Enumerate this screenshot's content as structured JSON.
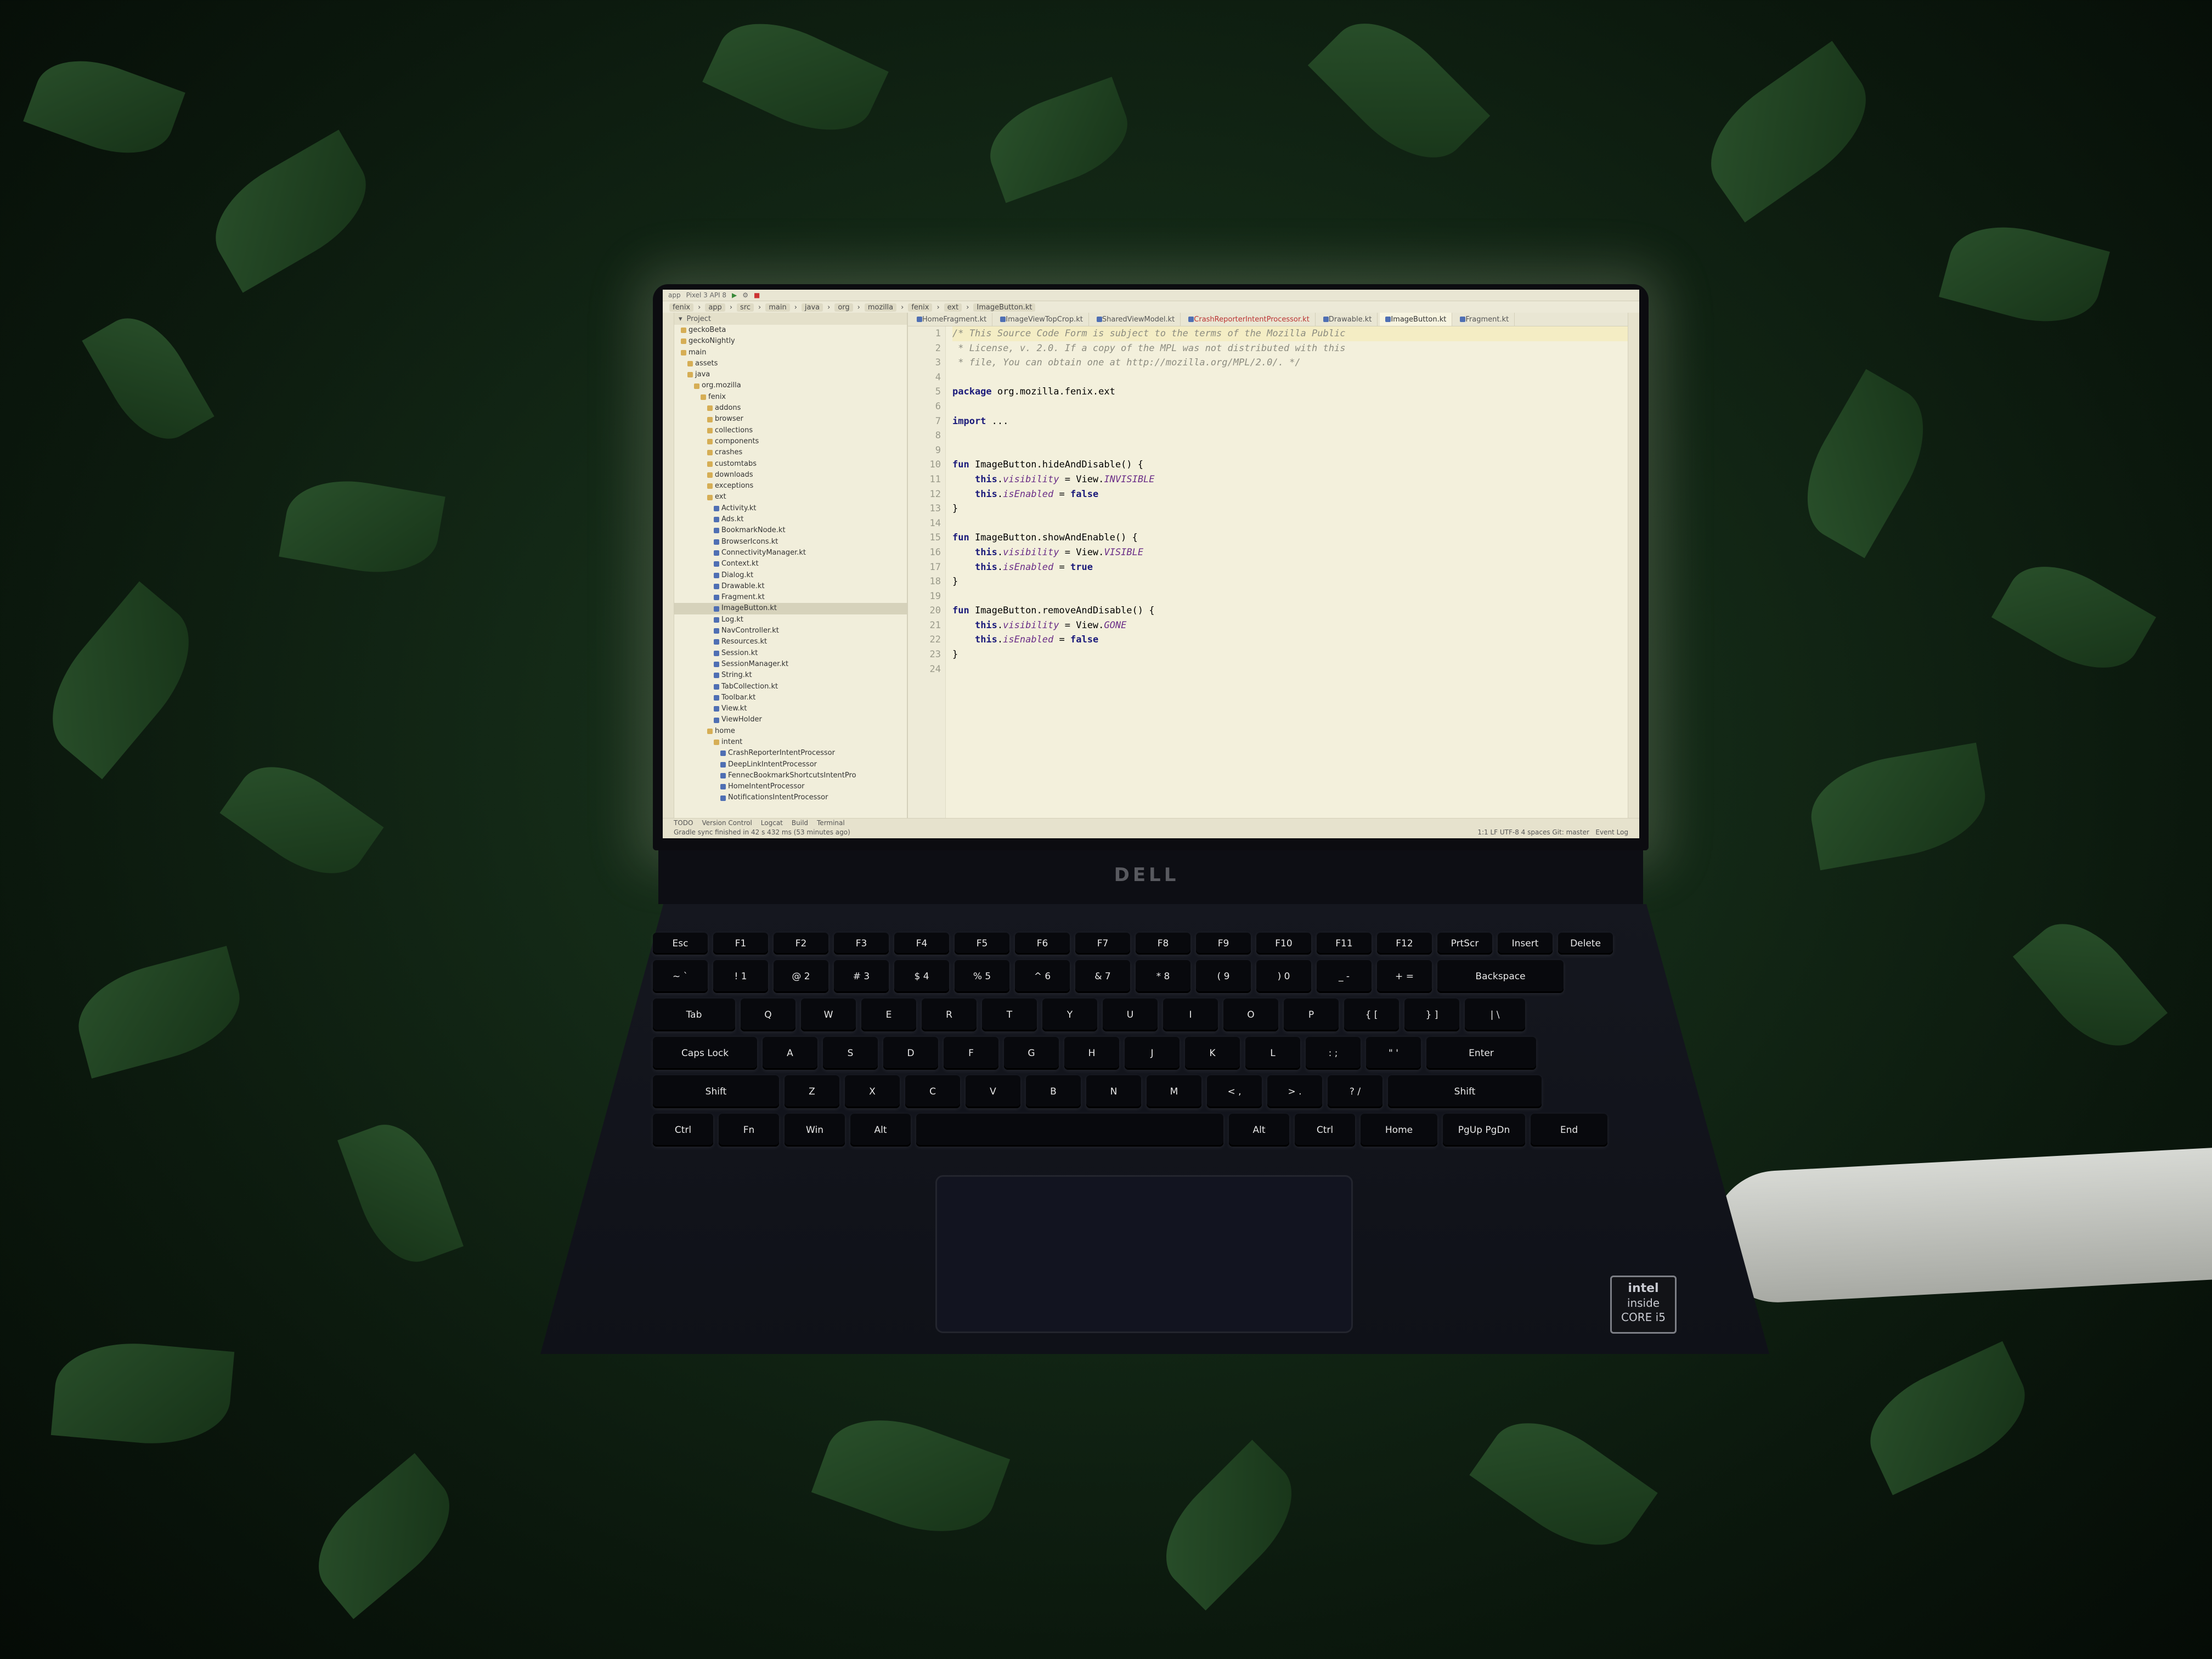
{
  "toolbar": {
    "run_config": "app",
    "device": "Pixel 3 API 8"
  },
  "breadcrumbs": [
    "fenix",
    "app",
    "src",
    "main",
    "java",
    "org",
    "mozilla",
    "fenix",
    "ext",
    "ImageButton.kt"
  ],
  "project_panel": {
    "title": "Project",
    "tree": [
      {
        "label": "geckoBeta",
        "type": "folder",
        "depth": 1
      },
      {
        "label": "geckoNightly",
        "type": "folder",
        "depth": 1
      },
      {
        "label": "main",
        "type": "folder",
        "depth": 1
      },
      {
        "label": "assets",
        "type": "folder",
        "depth": 2
      },
      {
        "label": "java",
        "type": "folder",
        "depth": 2
      },
      {
        "label": "org.mozilla",
        "type": "folder",
        "depth": 3
      },
      {
        "label": "fenix",
        "type": "folder",
        "depth": 4
      },
      {
        "label": "addons",
        "type": "folder",
        "depth": 5
      },
      {
        "label": "browser",
        "type": "folder",
        "depth": 5
      },
      {
        "label": "collections",
        "type": "folder",
        "depth": 5
      },
      {
        "label": "components",
        "type": "folder",
        "depth": 5
      },
      {
        "label": "crashes",
        "type": "folder",
        "depth": 5
      },
      {
        "label": "customtabs",
        "type": "folder",
        "depth": 5
      },
      {
        "label": "downloads",
        "type": "folder",
        "depth": 5
      },
      {
        "label": "exceptions",
        "type": "folder",
        "depth": 5
      },
      {
        "label": "ext",
        "type": "folder",
        "depth": 5
      },
      {
        "label": "Activity.kt",
        "type": "file",
        "depth": 6
      },
      {
        "label": "Ads.kt",
        "type": "file",
        "depth": 6
      },
      {
        "label": "BookmarkNode.kt",
        "type": "file",
        "depth": 6
      },
      {
        "label": "BrowserIcons.kt",
        "type": "file",
        "depth": 6
      },
      {
        "label": "ConnectivityManager.kt",
        "type": "file",
        "depth": 6
      },
      {
        "label": "Context.kt",
        "type": "file",
        "depth": 6
      },
      {
        "label": "Dialog.kt",
        "type": "file",
        "depth": 6
      },
      {
        "label": "Drawable.kt",
        "type": "file",
        "depth": 6
      },
      {
        "label": "Fragment.kt",
        "type": "file",
        "depth": 6
      },
      {
        "label": "ImageButton.kt",
        "type": "file",
        "depth": 6,
        "selected": true
      },
      {
        "label": "Log.kt",
        "type": "file",
        "depth": 6
      },
      {
        "label": "NavController.kt",
        "type": "file",
        "depth": 6
      },
      {
        "label": "Resources.kt",
        "type": "file",
        "depth": 6
      },
      {
        "label": "Session.kt",
        "type": "file",
        "depth": 6
      },
      {
        "label": "SessionManager.kt",
        "type": "file",
        "depth": 6
      },
      {
        "label": "String.kt",
        "type": "file",
        "depth": 6
      },
      {
        "label": "TabCollection.kt",
        "type": "file",
        "depth": 6
      },
      {
        "label": "Toolbar.kt",
        "type": "file",
        "depth": 6
      },
      {
        "label": "View.kt",
        "type": "file",
        "depth": 6
      },
      {
        "label": "ViewHolder",
        "type": "file",
        "depth": 6
      },
      {
        "label": "home",
        "type": "folder",
        "depth": 5
      },
      {
        "label": "intent",
        "type": "folder",
        "depth": 6
      },
      {
        "label": "CrashReporterIntentProcessor",
        "type": "file",
        "depth": 7
      },
      {
        "label": "DeepLinkIntentProcessor",
        "type": "file",
        "depth": 7
      },
      {
        "label": "FennecBookmarkShortcutsIntentPro",
        "type": "file",
        "depth": 7
      },
      {
        "label": "HomeIntentProcessor",
        "type": "file",
        "depth": 7
      },
      {
        "label": "NotificationsIntentProcessor",
        "type": "file",
        "depth": 7
      }
    ]
  },
  "editor_tabs": [
    {
      "label": "HomeFragment.kt",
      "active": false,
      "error": false
    },
    {
      "label": "ImageViewTopCrop.kt",
      "active": false,
      "error": false
    },
    {
      "label": "SharedViewModel.kt",
      "active": false,
      "error": false
    },
    {
      "label": "CrashReporterIntentProcessor.kt",
      "active": false,
      "error": true
    },
    {
      "label": "Drawable.kt",
      "active": false,
      "error": false
    },
    {
      "label": "ImageButton.kt",
      "active": true,
      "error": false
    },
    {
      "label": "Fragment.kt",
      "active": false,
      "error": false
    }
  ],
  "code_lines": [
    "/* This Source Code Form is subject to the terms of the Mozilla Public",
    " * License, v. 2.0. If a copy of the MPL was not distributed with this",
    " * file, You can obtain one at http://mozilla.org/MPL/2.0/. */",
    "",
    "package org.mozilla.fenix.ext",
    "",
    "import ...",
    "",
    "",
    "fun ImageButton.hideAndDisable() {",
    "    this.visibility = View.INVISIBLE",
    "    this.isEnabled = false",
    "}",
    "",
    "fun ImageButton.showAndEnable() {",
    "    this.visibility = View.VISIBLE",
    "    this.isEnabled = true",
    "}",
    "",
    "fun ImageButton.removeAndDisable() {",
    "    this.visibility = View.GONE",
    "    this.isEnabled = false",
    "}",
    ""
  ],
  "status_bar": {
    "tool_windows": [
      "TODO",
      "Version Control",
      "Logcat",
      "Build",
      "Terminal"
    ],
    "message": "Gradle sync finished in 42 s 432 ms (53 minutes ago)",
    "right": "1:1  LF  UTF-8  4 spaces  Git: master",
    "event_log": "Event Log"
  },
  "laptop": {
    "brand": "DELL",
    "badge_line1": "intel",
    "badge_line2": "inside",
    "badge_line3": "CORE i5"
  },
  "keyboard": {
    "rows": [
      [
        "Esc",
        "F1",
        "F2",
        "F3",
        "F4",
        "F5",
        "F6",
        "F7",
        "F8",
        "F9",
        "F10",
        "F11",
        "F12",
        "PrtScr",
        "Insert",
        "Delete"
      ],
      [
        "~ `",
        "! 1",
        "@ 2",
        "# 3",
        "$ 4",
        "% 5",
        "^ 6",
        "& 7",
        "* 8",
        "( 9",
        ") 0",
        "_ -",
        "+ =",
        "Backspace"
      ],
      [
        "Tab",
        "Q",
        "W",
        "E",
        "R",
        "T",
        "Y",
        "U",
        "I",
        "O",
        "P",
        "{ [",
        "} ]",
        "| \\"
      ],
      [
        "Caps Lock",
        "A",
        "S",
        "D",
        "F",
        "G",
        "H",
        "J",
        "K",
        "L",
        ": ;",
        "\" '",
        "Enter"
      ],
      [
        "Shift",
        "Z",
        "X",
        "C",
        "V",
        "B",
        "N",
        "M",
        "< ,",
        "> .",
        "? /",
        "Shift"
      ],
      [
        "Ctrl",
        "Fn",
        "Win",
        "Alt",
        "",
        "Alt",
        "Ctrl",
        "Home",
        "PgUp PgDn",
        "End"
      ]
    ]
  }
}
